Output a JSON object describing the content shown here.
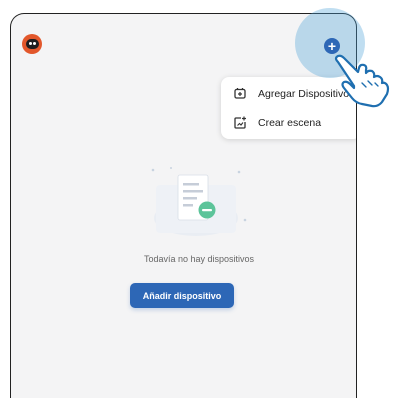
{
  "header": {
    "avatar_icon": "robot-avatar-icon",
    "add_icon": "plus-circle-icon"
  },
  "menu": {
    "items": [
      {
        "label": "Agregar Dispositivo",
        "icon": "add-device-icon"
      },
      {
        "label": "Crear escena",
        "icon": "create-scene-icon"
      }
    ]
  },
  "empty_state": {
    "message": "Todavía no hay dispositivos",
    "button_label": "Añadir dispositivo",
    "illustration_icon": "empty-document-illustration"
  },
  "colors": {
    "accent": "#2d67b6",
    "avatar": "#e2572b",
    "highlight": "#4aa0d7",
    "illustration_green": "#5cc49a"
  }
}
